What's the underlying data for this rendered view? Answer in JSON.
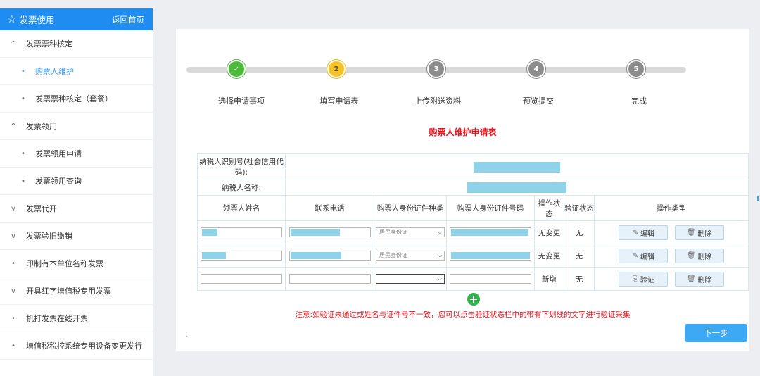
{
  "sidebar": {
    "title": "发票使用",
    "home_link": "返回首页",
    "items": [
      {
        "label": "发票票种核定",
        "marker": "^",
        "level": 1
      },
      {
        "label": "购票人维护",
        "marker": "•",
        "level": 2,
        "active": true
      },
      {
        "label": "发票票种核定（套餐）",
        "marker": "•",
        "level": 2
      },
      {
        "label": "发票领用",
        "marker": "^",
        "level": 1
      },
      {
        "label": "发票领用申请",
        "marker": "•",
        "level": 2
      },
      {
        "label": "发票领用查询",
        "marker": "•",
        "level": 2
      },
      {
        "label": "发票代开",
        "marker": "v",
        "level": 1
      },
      {
        "label": "发票验旧缴销",
        "marker": "v",
        "level": 1
      },
      {
        "label": "印制有本单位名称发票",
        "marker": "•",
        "level": 1
      },
      {
        "label": "开具红字增值税专用发票",
        "marker": "v",
        "level": 1
      },
      {
        "label": "机打发票在线开票",
        "marker": "•",
        "level": 1
      },
      {
        "label": "增值税税控系统专用设备变更发行",
        "marker": "•",
        "level": 1
      }
    ]
  },
  "steps": [
    {
      "num": "✓",
      "label": "选择申请事项",
      "state": "done"
    },
    {
      "num": "2",
      "label": "填写申请表",
      "state": "current"
    },
    {
      "num": "3",
      "label": "上传附送资料",
      "state": "todo"
    },
    {
      "num": "4",
      "label": "预览提交",
      "state": "todo"
    },
    {
      "num": "5",
      "label": "完成",
      "state": "todo"
    }
  ],
  "form": {
    "title": "购票人维护申请表",
    "taxpayer_id_label": "纳税人识别号(社会信用代码):",
    "taxpayer_name_label": "纳税人名称:",
    "headers": {
      "name": "领票人姓名",
      "phone": "联系电话",
      "id_type": "购票人身份证件种类",
      "id_number": "购票人身份证件号码",
      "op_status": "操作状态",
      "verify_status": "验证状态",
      "op_type": "操作类型"
    },
    "rows": [
      {
        "id_type": "居民身份证",
        "op_status": "无变更",
        "verify_status": "无",
        "btn1": "编辑",
        "btn2": "删除"
      },
      {
        "id_type": "居民身份证",
        "op_status": "无变更",
        "verify_status": "无",
        "btn1": "编辑",
        "btn2": "删除"
      },
      {
        "id_type": "",
        "op_status": "新增",
        "verify_status": "无",
        "btn1": "验证",
        "btn2": "删除"
      }
    ],
    "add_icon": "+",
    "note": "注意:如验证未通过或姓名与证件号不一致，您可以点击验证状态栏中的带有下划线的文字进行验证采集",
    "next_button": "下一步",
    "footer_mark": "."
  },
  "colors": {
    "primary": "#1e8cf0",
    "alert": "#e8141e",
    "redacted": "#8fd3ea",
    "step_done": "#4cbb3a",
    "step_current": "#f6c225",
    "step_todo": "#8c8c8c"
  }
}
